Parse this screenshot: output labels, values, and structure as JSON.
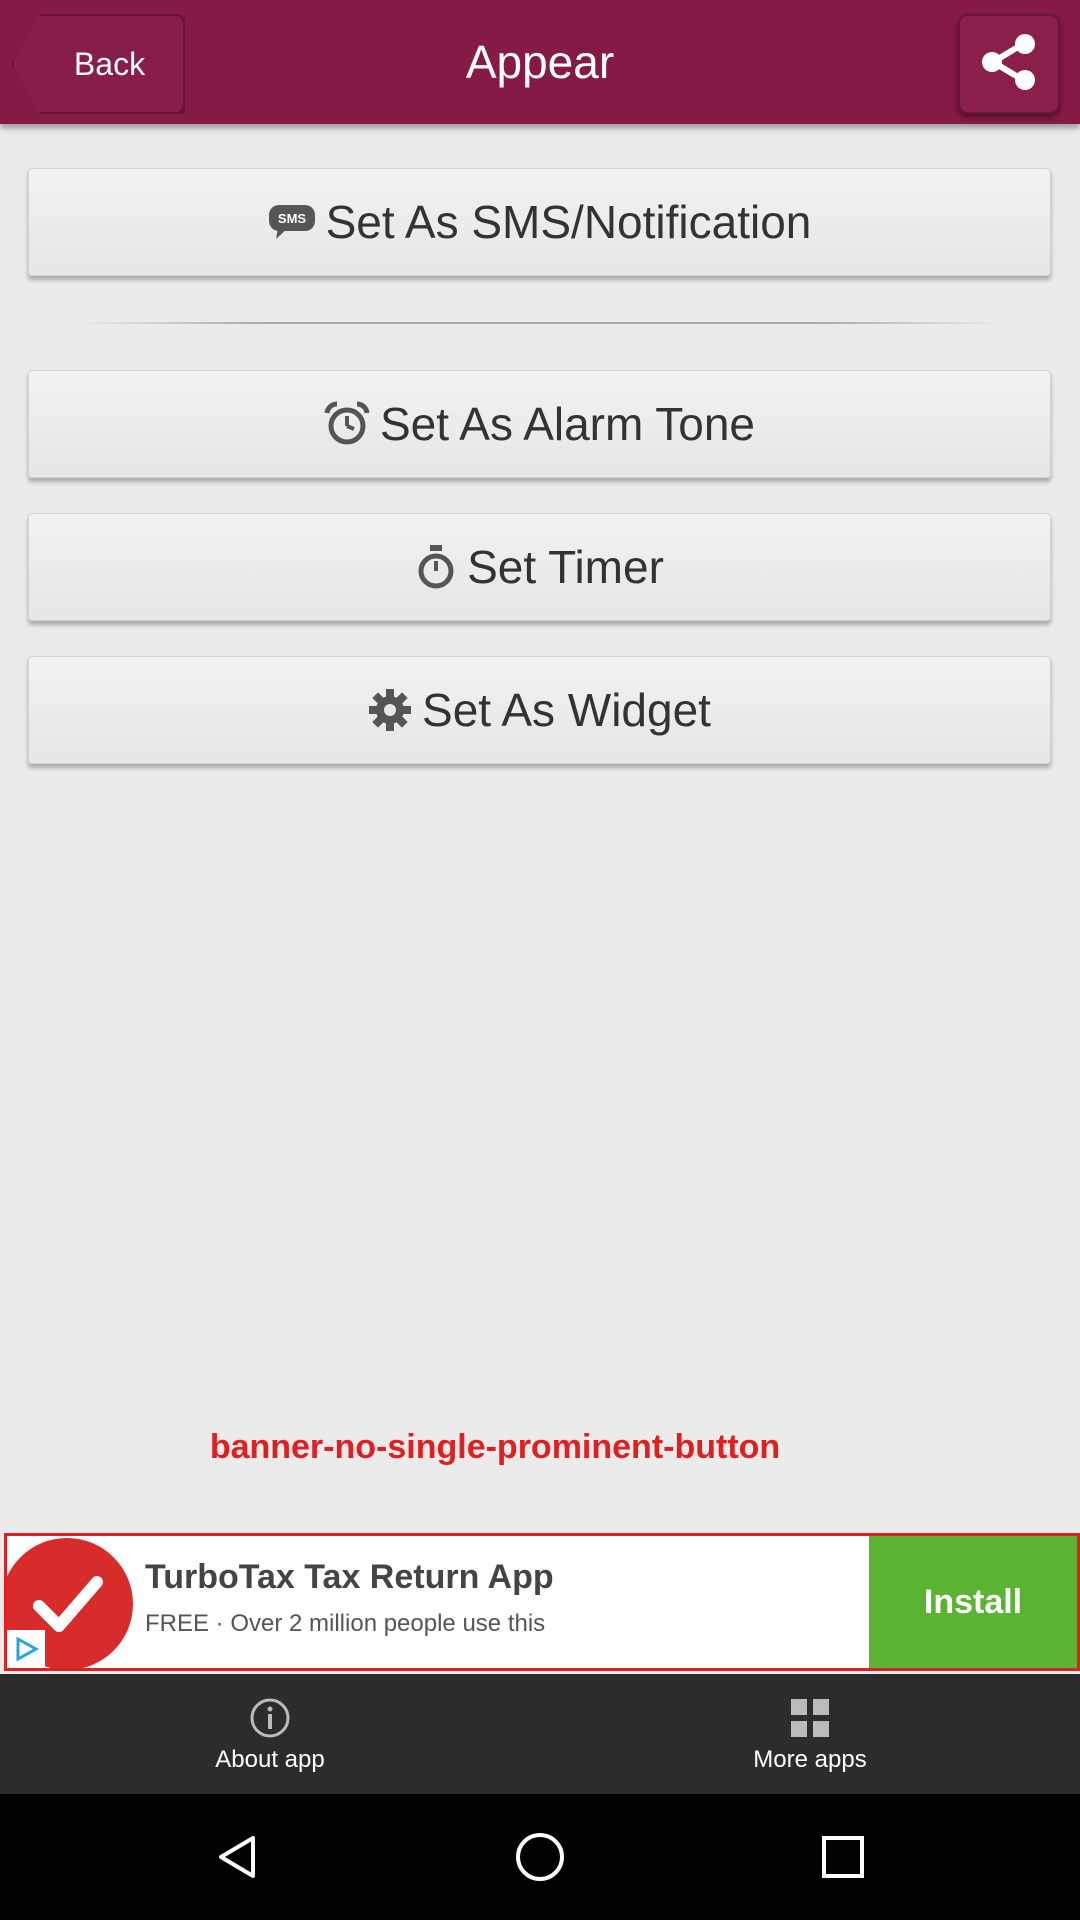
{
  "header": {
    "back_label": "Back",
    "title": "Appear",
    "share_icon": "share-icon",
    "bg_color": "#861a46"
  },
  "actions": [
    {
      "label": "Set As SMS/Notification",
      "icon": "sms-icon"
    },
    {
      "label": "Set As Alarm Tone",
      "icon": "alarm-clock-icon"
    },
    {
      "label": "Set Timer",
      "icon": "stopwatch-icon"
    },
    {
      "label": "Set As Widget",
      "icon": "gear-icon"
    }
  ],
  "annotation": {
    "text": "banner-no-single-prominent-button",
    "color": "#e02020"
  },
  "ad": {
    "title": "TurboTax Tax Return App",
    "subtitle": "FREE · Over 2 million people use this",
    "install_label": "Install",
    "logo_icon": "checkmark-icon",
    "install_color": "#5bb332"
  },
  "bottom_bar": {
    "items": [
      {
        "label": "About app",
        "icon": "info-icon"
      },
      {
        "label": "More apps",
        "icon": "grid-icon"
      }
    ]
  },
  "system_nav": {
    "back_icon": "nav-back-icon",
    "home_icon": "nav-home-icon",
    "recents_icon": "nav-recents-icon"
  }
}
